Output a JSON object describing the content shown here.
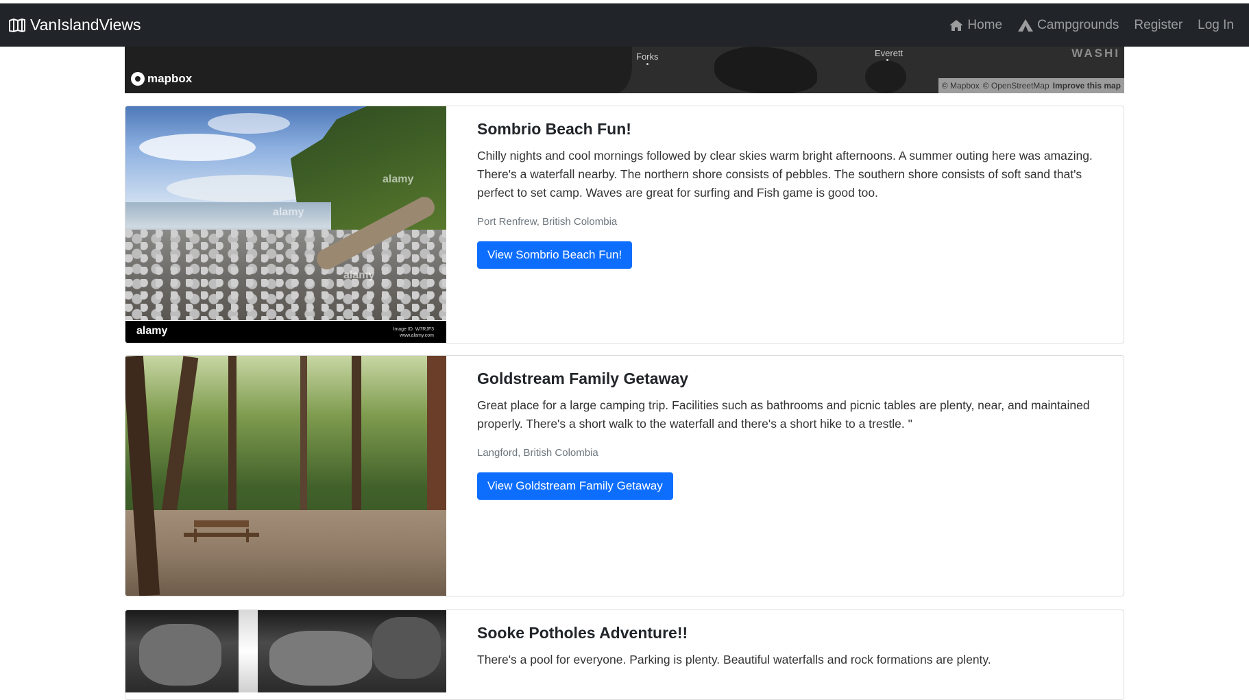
{
  "brand": {
    "name": "VanIslandViews",
    "icon": "map-icon"
  },
  "nav": [
    {
      "label": "Home",
      "icon": "home-icon"
    },
    {
      "label": "Campgrounds",
      "icon": "tent-icon"
    },
    {
      "label": "Register",
      "icon": ""
    },
    {
      "label": "Log In",
      "icon": ""
    }
  ],
  "map": {
    "logo": "mapbox",
    "labels": {
      "forks": "Forks",
      "everett": "Everett",
      "state": "WASHI"
    },
    "attribution": {
      "mapbox": "© Mapbox",
      "osm": "© OpenStreetMap",
      "improve": "Improve this map"
    }
  },
  "campgrounds": [
    {
      "title": "Sombrio Beach Fun!",
      "description": "Chilly nights and cool mornings followed by clear skies warm bright afternoons. A summer outing here was amazing. There's a waterfall nearby. The northern shore consists of pebbles. The southern shore consists of soft sand that's perfect to set camp. Waves are great for surfing and Fish game is good too.",
      "location": "Port Renfrew, British Colombia",
      "button": "View Sombrio Beach Fun!",
      "watermark": "alamy",
      "image_footer_brand": "alamy",
      "image_footer_id": "Image ID: W7RJF3",
      "image_footer_url": "www.alamy.com"
    },
    {
      "title": "Goldstream Family Getaway",
      "description": "Great place for a large camping trip. Facilities such as bathrooms and picnic tables are plenty, near, and maintained properly. There's a short walk to the waterfall and there's a short hike to a trestle. \"",
      "location": "Langford, British Colombia",
      "button": "View Goldstream Family Getaway"
    },
    {
      "title": "Sooke Potholes Adventure!!",
      "description": "There's a pool for everyone. Parking is plenty. Beautiful waterfalls and rock formations are plenty."
    }
  ],
  "colors": {
    "navbar": "#212529",
    "primary_button": "#0d6efd",
    "muted_text": "#6c757d"
  }
}
